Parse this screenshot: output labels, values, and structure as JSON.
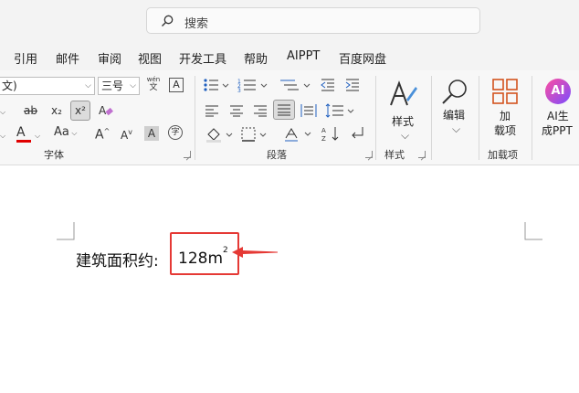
{
  "search": {
    "placeholder": "搜索"
  },
  "menu": [
    "引用",
    "邮件",
    "审阅",
    "视图",
    "开发工具",
    "帮助",
    "AIPPT",
    "百度网盘"
  ],
  "font_group": {
    "font_name": "文)",
    "font_size": "三号",
    "wen_top": "wén",
    "wen_bottom": "文",
    "strike": "ab",
    "subscript": "x₂",
    "superscript": "x²",
    "font_color_glyph": "A",
    "aa_label": "Aa",
    "grow_label": "A",
    "shrink_label": "A",
    "char_shade": "A",
    "enclose": "字",
    "label": "字体"
  },
  "paragraph_group": {
    "label": "段落"
  },
  "styles_group": {
    "button": "样式",
    "label": "样式"
  },
  "edit_group": {
    "button": "编辑"
  },
  "addins_group": {
    "button_line1": "加",
    "button_line2": "载项",
    "label": "加载项"
  },
  "ai_group": {
    "logo": "AI",
    "button_line1": "AI生",
    "button_line2": "成PPT"
  },
  "document": {
    "label": "建筑面积约:",
    "value": "128m",
    "superscript": "2"
  },
  "colors": {
    "highlight": "#e53935",
    "font_color": "#e00000"
  }
}
